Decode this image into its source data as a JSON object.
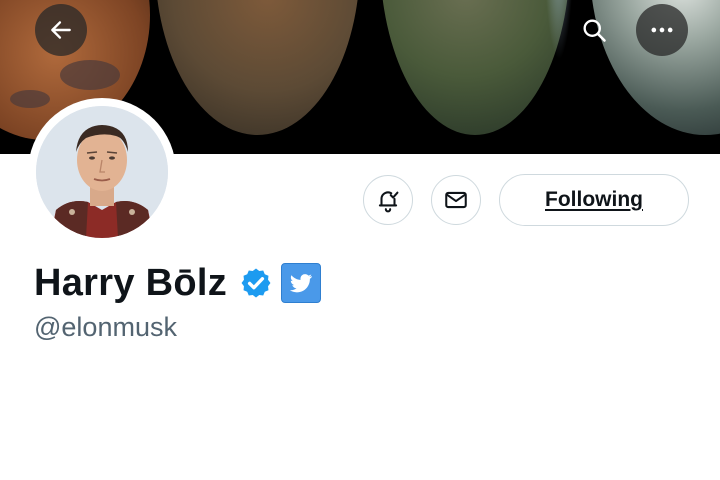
{
  "profile": {
    "display_name": "Harry Bōlz",
    "handle": "@elonmusk",
    "verified": true
  },
  "header": {
    "back_icon": "arrow-left-icon",
    "search_icon": "search-icon",
    "more_icon": "more-horizontal-icon"
  },
  "actions": {
    "follow_label": "Following",
    "bell_icon": "bell-check-icon",
    "mail_icon": "mail-icon"
  },
  "colors": {
    "verified_blue": "#1d9bf0",
    "twitter_badge_blue": "#4a99e9",
    "handle_gray": "#536471",
    "text_dark": "#0f1419"
  }
}
